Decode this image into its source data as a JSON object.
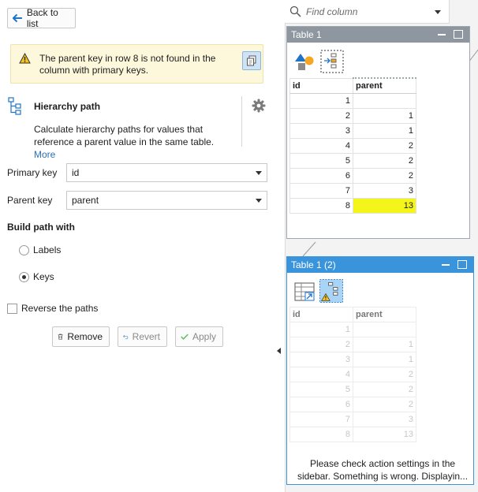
{
  "sidebar": {
    "back_label": "Back to list",
    "warning": {
      "text": "The parent key in row 8 is not found in the column with primary keys."
    },
    "action": {
      "title": "Hierarchy path",
      "description": "Calculate hierarchy paths for values that reference a parent value in the same table.",
      "more_link": "More"
    },
    "primary_key": {
      "label": "Primary key",
      "value": "id"
    },
    "parent_key": {
      "label": "Parent key",
      "value": "parent"
    },
    "build": {
      "title": "Build path with",
      "options": [
        {
          "label": "Labels",
          "selected": false
        },
        {
          "label": "Keys",
          "selected": true
        }
      ]
    },
    "reverse": {
      "label": "Reverse the paths",
      "checked": false
    },
    "buttons": {
      "remove": "Remove",
      "revert": "Revert",
      "apply": "Apply"
    }
  },
  "workspace": {
    "find": {
      "placeholder": "Find column"
    },
    "table1": {
      "title": "Table 1",
      "columns": [
        "id",
        "parent"
      ],
      "rows": [
        [
          "1",
          ""
        ],
        [
          "2",
          "1"
        ],
        [
          "3",
          "1"
        ],
        [
          "4",
          "2"
        ],
        [
          "5",
          "2"
        ],
        [
          "6",
          "2"
        ],
        [
          "7",
          "3"
        ],
        [
          "8",
          "13"
        ]
      ],
      "highlight_color": "#f4f51a"
    },
    "table2": {
      "title": "Table 1 (2)",
      "columns": [
        "id",
        "parent"
      ],
      "rows": [
        [
          "1",
          ""
        ],
        [
          "2",
          "1"
        ],
        [
          "3",
          "1"
        ],
        [
          "4",
          "2"
        ],
        [
          "5",
          "2"
        ],
        [
          "6",
          "2"
        ],
        [
          "7",
          "3"
        ],
        [
          "8",
          "13"
        ]
      ],
      "message": "Please check action settings in the sidebar. Something is wrong. Displayin..."
    }
  },
  "colors": {
    "accent": "#3a94dc",
    "panel_inactive": "#8e979f",
    "warning_bg": "#fdf7dc"
  }
}
